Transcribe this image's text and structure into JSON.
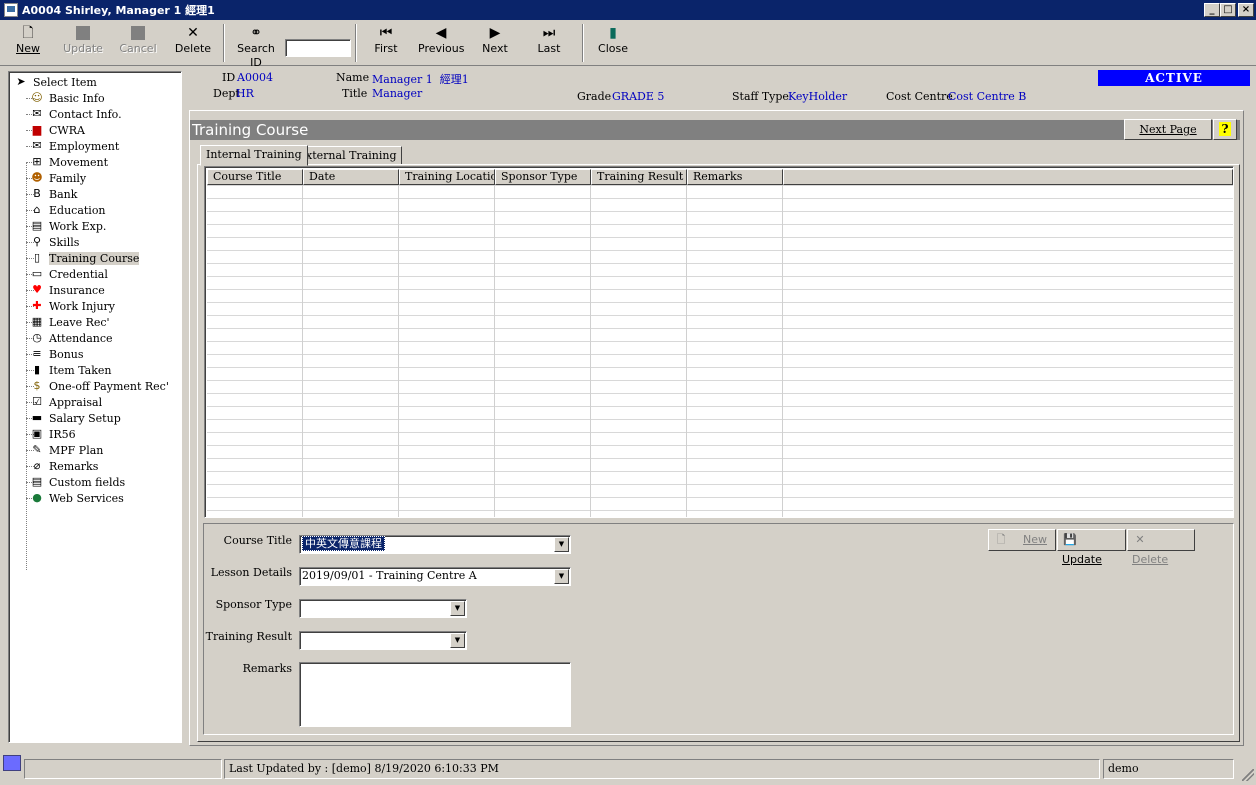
{
  "window": {
    "title": "A0004 Shirley, Manager 1 經理1",
    "minimize": "_",
    "maximize": "□",
    "close": "×"
  },
  "toolbar": {
    "new": "New",
    "update": "Update",
    "cancel": "Cancel",
    "delete": "Delete",
    "search_id": "Search ID",
    "search_value": "",
    "first": "First",
    "previous": "Previous",
    "next": "Next",
    "last": "Last",
    "close": "Close"
  },
  "tree": {
    "root": "Select Item",
    "items": [
      {
        "label": "Basic Info",
        "icon": "person-icon"
      },
      {
        "label": "Contact Info.",
        "icon": "envelope-icon"
      },
      {
        "label": "CWRA",
        "icon": "book-icon"
      },
      {
        "label": "Employment",
        "icon": "mail-icon"
      },
      {
        "label": "Movement",
        "icon": "org-chart-icon"
      },
      {
        "label": "Family",
        "icon": "face-icon"
      },
      {
        "label": "Bank",
        "icon": "bank-icon"
      },
      {
        "label": "Education",
        "icon": "graduation-icon"
      },
      {
        "label": "Work Exp.",
        "icon": "document-icon"
      },
      {
        "label": "Skills",
        "icon": "tools-icon"
      },
      {
        "label": "Training Course",
        "icon": "training-icon"
      },
      {
        "label": "Credential",
        "icon": "id-card-icon"
      },
      {
        "label": "Insurance",
        "icon": "heart-icon"
      },
      {
        "label": "Work Injury",
        "icon": "cross-icon"
      },
      {
        "label": "Leave Rec'",
        "icon": "calendar-icon"
      },
      {
        "label": "Attendance",
        "icon": "clock-icon"
      },
      {
        "label": "Bonus",
        "icon": "coins-icon"
      },
      {
        "label": "Item Taken",
        "icon": "item-icon"
      },
      {
        "label": "One-off Payment Rec'",
        "icon": "dollar-icon"
      },
      {
        "label": "Appraisal",
        "icon": "checklist-icon"
      },
      {
        "label": "Salary Setup",
        "icon": "salary-icon"
      },
      {
        "label": "IR56",
        "icon": "form-icon"
      },
      {
        "label": "MPF Plan",
        "icon": "mpf-icon"
      },
      {
        "label": "Remarks",
        "icon": "paperclip-icon"
      },
      {
        "label": "Custom fields",
        "icon": "custom-icon"
      },
      {
        "label": "Web Services",
        "icon": "globe-icon"
      }
    ]
  },
  "header": {
    "id_label": "ID",
    "id_value": "A0004",
    "dept_label": "Dept",
    "dept_value": "HR",
    "name_label": "Name",
    "name_value": "Manager 1  經理1",
    "title_label": "Title",
    "title_value": "Manager",
    "grade_label": "Grade",
    "grade_value": "GRADE 5",
    "staff_type_label": "Staff Type",
    "staff_type_value": "KeyHolder",
    "cost_centre_label": "Cost Centre",
    "cost_centre_value": "Cost Centre B",
    "status": "ACTIVE"
  },
  "section": {
    "title": "Training Course",
    "next_page": "Next Page",
    "help": "?"
  },
  "tabs": [
    {
      "label": "Internal Training",
      "active": true
    },
    {
      "label": "External Training",
      "active": false
    }
  ],
  "grid": {
    "columns": [
      "Course Title",
      "Date",
      "Training Location",
      "Sponsor Type",
      "Training Result",
      "Remarks"
    ],
    "rows": []
  },
  "form": {
    "course_title_label": "Course Title",
    "course_title_value": "中英文傳意課程",
    "lesson_details_label": "Lesson Details",
    "lesson_details_value": "2019/09/01 - Training Centre A",
    "sponsor_type_label": "Sponsor Type",
    "sponsor_type_value": "",
    "training_result_label": "Training Result",
    "training_result_value": "",
    "remarks_label": "Remarks",
    "remarks_value": "",
    "new_btn": "New",
    "update_btn": "Update",
    "delete_btn": "Delete"
  },
  "status": {
    "last_updated": "Last Updated by : [demo]  8/19/2020 6:10:33 PM",
    "user": "demo"
  },
  "colors": {
    "titlebar": "#0a246a",
    "active_badge": "#0000ff",
    "value_text": "#0000c0",
    "section_bar": "#808080"
  }
}
